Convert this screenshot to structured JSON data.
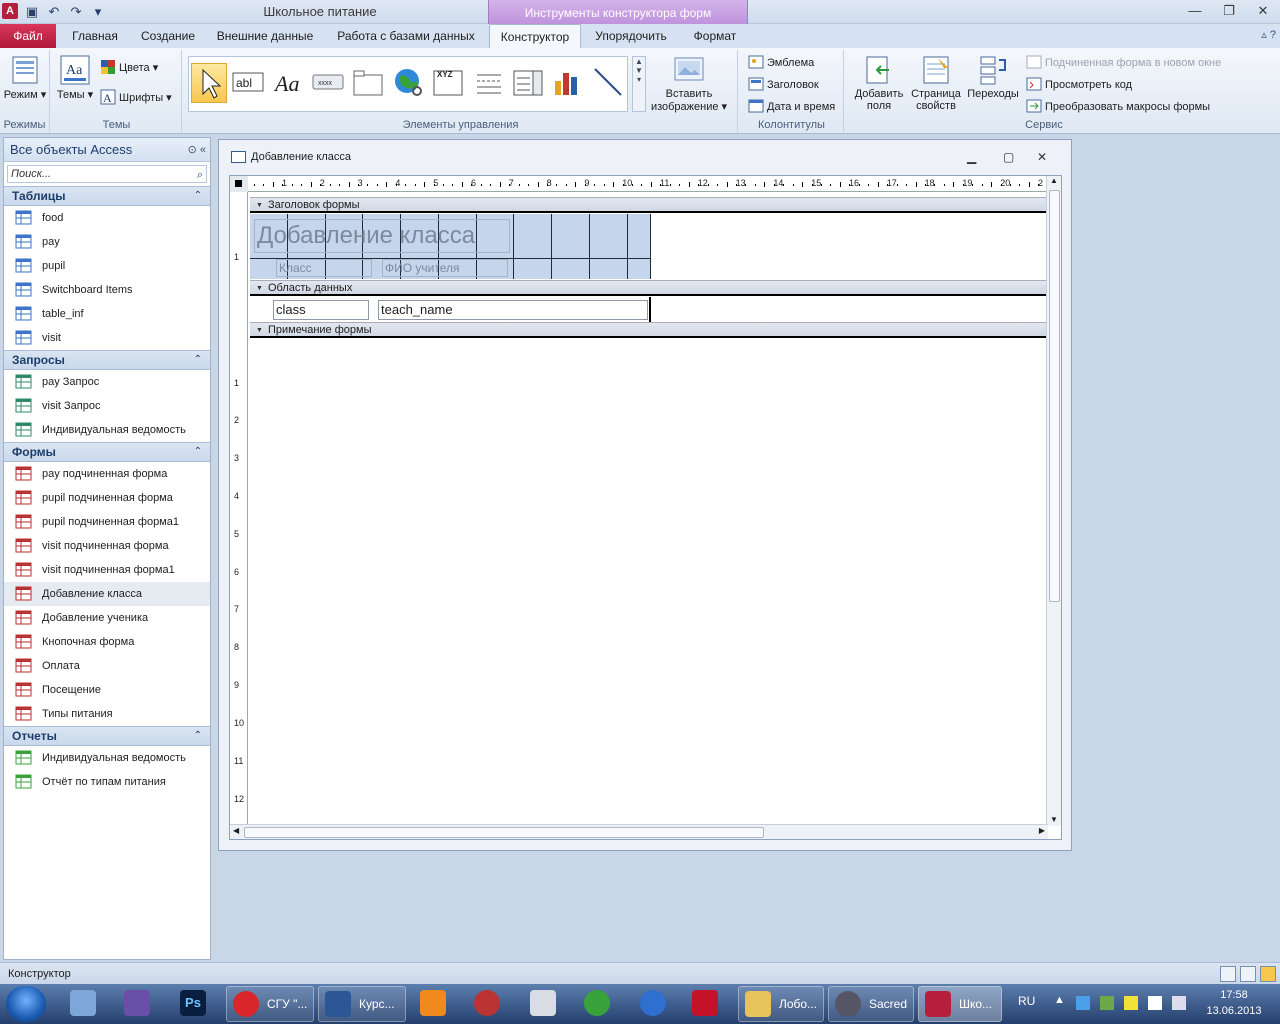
{
  "window": {
    "title": "Школьное питание",
    "context_tab_header": "Инструменты конструктора форм"
  },
  "ribbon_tabs": {
    "file": "Файл",
    "items": [
      "Главная",
      "Создание",
      "Внешние данные",
      "Работа с базами данных",
      "Конструктор",
      "Упорядочить",
      "Формат"
    ],
    "active": "Конструктор"
  },
  "ribbon": {
    "modes": {
      "button": "Режим",
      "group": "Режимы"
    },
    "themes": {
      "themes_btn": "Темы",
      "colors": "Цвета",
      "fonts": "Шрифты",
      "group": "Темы"
    },
    "controls": {
      "group": "Элементы управления",
      "insert_image": "Вставить изображение"
    },
    "headers": {
      "logo": "Эмблема",
      "title": "Заголовок",
      "datetime": "Дата и время",
      "group": "Колонтитулы"
    },
    "tools": {
      "add_fields": "Добавить поля",
      "property_sheet": "Страница свойств",
      "tab_order": "Переходы",
      "subform_new_window": "Подчиненная форма в новом окне",
      "view_code": "Просмотреть код",
      "convert_macros": "Преобразовать макросы формы",
      "group": "Сервис"
    }
  },
  "nav": {
    "header": "Все объекты Access",
    "search_placeholder": "Поиск...",
    "groups": [
      {
        "name": "Таблицы",
        "items": [
          "food",
          "pay",
          "pupil",
          "Switchboard Items",
          "table_inf",
          "visit"
        ]
      },
      {
        "name": "Запросы",
        "items": [
          "pay Запрос",
          "visit Запрос",
          "Индивидуальная ведомость"
        ]
      },
      {
        "name": "Формы",
        "items": [
          "pay подчиненная форма",
          "pupil подчиненная форма",
          "pupil подчиненная форма1",
          "visit подчиненная форма",
          "visit подчиненная форма1",
          "Добавление класса",
          "Добавление ученика",
          "Кнопочная форма",
          "Оплата",
          "Посещение",
          "Типы питания"
        ]
      },
      {
        "name": "Отчеты",
        "items": [
          "Индивидуальная ведомость",
          "Отчёт по типам питания"
        ]
      }
    ],
    "selected": "Добавление класса"
  },
  "document": {
    "title": "Добавление класса",
    "sections": {
      "header": "Заголовок формы",
      "detail": "Область данных",
      "footer": "Примечание формы"
    },
    "form_title": "Добавление класса",
    "labels": {
      "class": "Класс",
      "teacher": "ФИО учителя"
    },
    "fields": {
      "class": "class",
      "teacher": "teach_name"
    },
    "ruler_h": [
      "1",
      "2",
      "3",
      "4",
      "5",
      "6",
      "7",
      "8",
      "9",
      "10",
      "11",
      "12",
      "13",
      "14",
      "15",
      "16",
      "17",
      "18",
      "19",
      "20",
      "2"
    ],
    "ruler_v": [
      "1",
      "1",
      "2",
      "3",
      "4",
      "5",
      "6",
      "7",
      "8",
      "9",
      "10",
      "11",
      "12"
    ]
  },
  "statusbar": {
    "text": "Конструктор"
  },
  "taskbar": {
    "buttons": [
      "СГУ \"...",
      "Курс...",
      "Лобо...",
      "Sacred",
      "Шко..."
    ],
    "lang": "RU",
    "time": "17:58",
    "date": "13.06.2013"
  }
}
